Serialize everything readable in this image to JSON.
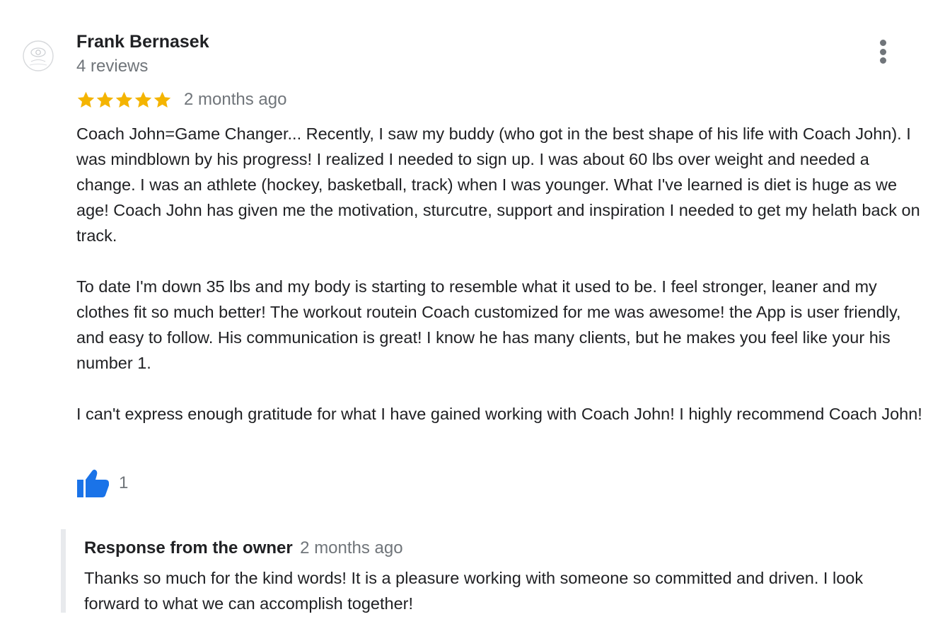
{
  "review": {
    "reviewer_name": "Frank Bernasek",
    "review_count": "4 reviews",
    "rating": 5,
    "rating_max": 5,
    "date": "2 months ago",
    "paragraphs": [
      "Coach John=Game Changer... Recently, I saw my buddy (who got in the best shape of his life with Coach John).  I was mindblown by his progress! I realized I needed to sign up.  I was about 60 lbs over weight and needed a change.  I was an athlete (hockey, basketball, track) when I was younger.  What I've learned is diet is huge as we age!  Coach John has given me the motivation, sturcutre, support and inspiration I needed to get my helath back on track.",
      "To date I'm down 35 lbs and my body is starting to resemble what it used to be.  I feel stronger, leaner and my clothes fit so much better!  The workout routein Coach customized for me was awesome!  the App is user friendly, and easy to follow.  His communication is great!  I know he has many clients, but he makes you feel like your his number 1.",
      "I can't express enough gratitude for what I have gained working with Coach John!  I highly recommend Coach John!"
    ],
    "like_count": "1"
  },
  "owner_response": {
    "label": "Response from the owner",
    "date": "2 months ago",
    "text": "Thanks so much for the kind words! It is a pleasure working with someone so committed and driven. I look forward to what we can accomplish together!"
  },
  "icons": {
    "avatar": "default-avatar-icon",
    "menu": "more-vert-icon",
    "star": "star-icon",
    "like": "thumbs-up-icon"
  },
  "colors": {
    "star": "#f4b400",
    "like": "#1a73e8",
    "secondary_text": "#70757a",
    "primary_text": "#202124",
    "response_border": "#e8eaed"
  }
}
